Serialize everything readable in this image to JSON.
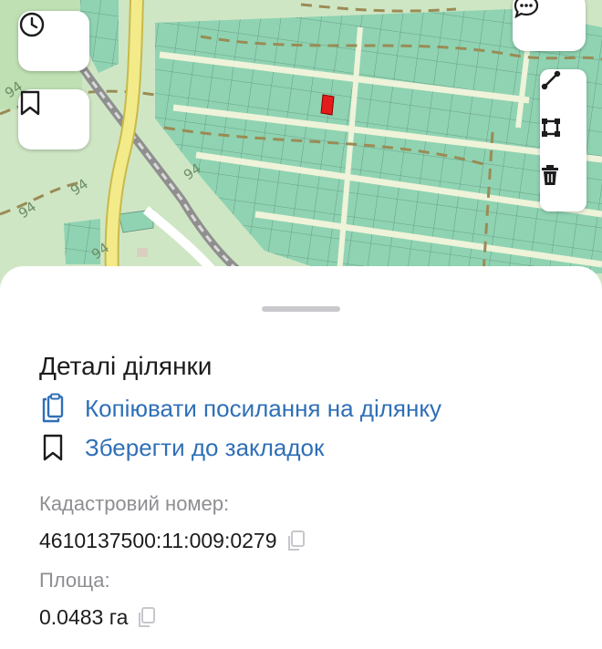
{
  "map": {
    "history_icon": "clock-icon",
    "bookmark_icon": "bookmark-icon",
    "chat_icon": "chat-bubble-icon",
    "tools": [
      "measure-line-icon",
      "measure-area-icon",
      "trash-icon"
    ],
    "road_labels": [
      "94",
      "94",
      "94",
      "94",
      "94"
    ]
  },
  "sheet": {
    "title": "Деталі ділянки",
    "copy_link_label": "Копіювати посилання на ділянку",
    "save_bookmark_label": "Зберегти до закладок",
    "cadastral_label": "Кадастровий номер:",
    "cadastral_value": "4610137500:11:009:0279",
    "area_label": "Площа:",
    "area_value": "0.0483 га"
  },
  "colors": {
    "accent": "#2f6fb7",
    "parcel_fill": "#8fd3b2",
    "selected_parcel": "#e31b1b",
    "map_background": "#cfe6c4",
    "road_yellow": "#f3ea8a"
  }
}
